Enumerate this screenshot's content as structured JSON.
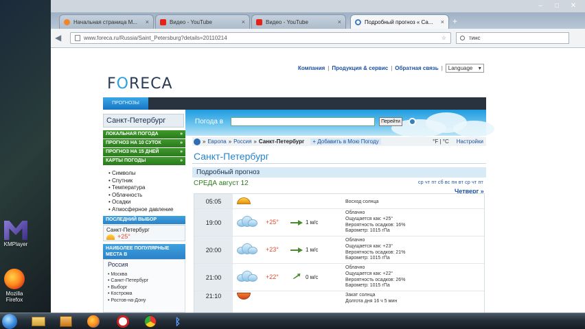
{
  "desktop": {
    "icons": [
      {
        "label": "KMPlayer",
        "icon": "kmplayer-icon"
      },
      {
        "label": "Mozilla Firefox",
        "icon": "firefox-icon"
      }
    ]
  },
  "browser": {
    "tabs": [
      {
        "title": "Начальная страница M...",
        "icon": "firefox-favicon",
        "color": "#f0852a"
      },
      {
        "title": "Видео - YouTube",
        "icon": "youtube-favicon",
        "color": "#e62117"
      },
      {
        "title": "Видео - YouTube",
        "icon": "youtube-favicon",
        "color": "#e62117"
      },
      {
        "title": "Подробный прогноз « Са...",
        "icon": "loading-favicon",
        "color": "#3a78c8"
      }
    ],
    "new_tab": "+",
    "window_buttons": {
      "minimize": "–",
      "maximize": "□",
      "close": "✕"
    },
    "address": "www.foreca.ru/Russia/Saint_Petersburg?details=20110214",
    "search_value": "тинс"
  },
  "page": {
    "top_links": [
      "Компания",
      "Продукция & сервис",
      "Обратная связь"
    ],
    "language": "Language",
    "logo": {
      "pre": "F",
      "o": "O",
      "post": "RECA"
    },
    "nav_tab": "ПРОГНОЗЫ",
    "city_header": "Санкт-Петербург",
    "search_label": "Погода в",
    "search_button": "Перейти",
    "menu": [
      "ЛОКАЛЬНАЯ ПОГОДА",
      "ПРОГНОЗ НА 10 СУТОК",
      "ПРОГНОЗ НА 15 ДНЕЙ",
      "КАРТЫ ПОГОДЫ"
    ],
    "menu_arrow": "»",
    "sublinks": [
      "• Символы",
      "• Спутник",
      "• Температура",
      "• Облачность",
      "• Осадки",
      "• Атмосферное давление"
    ],
    "recent": {
      "heading": "ПОСЛЕДНИЙ ВЫБОР",
      "city": "Санкт-Петербург",
      "temp": "+25°"
    },
    "popular": {
      "heading": "НАИБОЛЕЕ ПОПУЛЯРНЫЕ МЕСТА В",
      "country": "Россия",
      "cities": [
        "• Москва",
        "• Санкт-Петербург",
        "• Выборг",
        "• Кострома",
        "• Ростов-на-Дону"
      ]
    },
    "breadcrumb": {
      "sep": "»",
      "items": [
        "Европа",
        "Россия",
        "Санкт-Петербург"
      ],
      "add": "+ Добавить в Мою Погоду",
      "units": "°F | °C",
      "settings": "Настройки"
    },
    "city_title": "Санкт-Петербург",
    "detail_title": "Подробный прогноз",
    "day_title": "СРЕДА август 12",
    "day_links": "ср чт пт сб вс пн вт ср чт пт",
    "next_day": "Четверг »",
    "rows": [
      {
        "time": "05:05",
        "icon": "sunrise-icon",
        "desc": [
          "Восход солнца"
        ]
      },
      {
        "time": "19:00",
        "icon": "cloudy-icon",
        "temp": "+25°",
        "wind": "1 м/с",
        "wind_dir": "east",
        "desc": [
          "Облачно",
          "Ощущается как: +25°",
          "Вероятность осадков: 16%",
          "Барометр: 1015 гПа"
        ]
      },
      {
        "time": "20:00",
        "icon": "cloudy-icon",
        "temp": "+23°",
        "wind": "1 м/с",
        "wind_dir": "east",
        "desc": [
          "Облачно",
          "Ощущается как: +23°",
          "Вероятность осадков: 21%",
          "Барометр: 1015 гПа"
        ]
      },
      {
        "time": "21:00",
        "icon": "cloudy-icon",
        "temp": "+22°",
        "wind": "0 м/с",
        "wind_dir": "northeast",
        "desc": [
          "Облачно",
          "Ощущается как: +22°",
          "Вероятность осадков: 26%",
          "Барометр: 1015 гПа"
        ]
      },
      {
        "time": "21:10",
        "icon": "sunset-icon",
        "desc": [
          "Закат солнца",
          "Долгота дня 16 ч 5 мин"
        ]
      }
    ]
  },
  "taskbar": {
    "items": [
      "start-orb",
      "explorer-icon",
      "media-player-icon",
      "firefox-icon",
      "record-icon",
      "chrome-icon",
      "bluetooth-icon"
    ]
  }
}
